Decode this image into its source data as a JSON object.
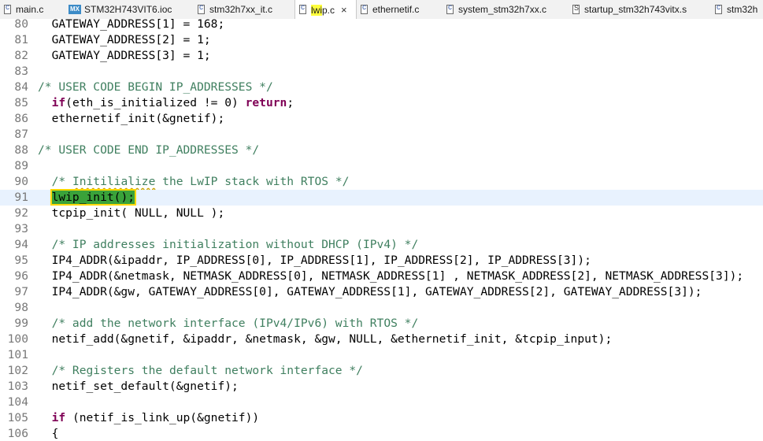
{
  "tabs": [
    {
      "label": "main.c",
      "icon": "c-file-icon",
      "active": false
    },
    {
      "label": "STM32H743VIT6.ioc",
      "icon": "mx-file-icon",
      "icon_text": "MX",
      "active": false
    },
    {
      "label": "stm32h7xx_it.c",
      "icon": "c-file-icon",
      "active": false
    },
    {
      "label": "lwip.c",
      "label_highlight": "lwi",
      "label_rest": "p.c",
      "icon": "c-file-icon",
      "active": true,
      "close_glyph": "×"
    },
    {
      "label": "ethernetif.c",
      "icon": "c-file-icon",
      "active": false
    },
    {
      "label": "system_stm32h7xx.c",
      "icon": "c-file-icon",
      "active": false
    },
    {
      "label": "startup_stm32h743vitx.s",
      "icon": "s-file-icon",
      "active": false
    },
    {
      "label": "stm32h",
      "icon": "c-file-icon",
      "active": false
    }
  ],
  "editor": {
    "current_line": 91,
    "lines": [
      {
        "n": "80",
        "code": "  GATEWAY_ADDRESS[1] = 168;"
      },
      {
        "n": "81",
        "code": "  GATEWAY_ADDRESS[2] = 1;"
      },
      {
        "n": "82",
        "code": "  GATEWAY_ADDRESS[3] = 1;"
      },
      {
        "n": "83",
        "code": ""
      },
      {
        "n": "84",
        "code": "/* USER CODE BEGIN IP_ADDRESSES */"
      },
      {
        "n": "85",
        "code": "  if(eth_is_initialized != 0) return;"
      },
      {
        "n": "86",
        "code": "  ethernetif_init(&gnetif);"
      },
      {
        "n": "87",
        "code": ""
      },
      {
        "n": "88",
        "code": "/* USER CODE END IP_ADDRESSES */"
      },
      {
        "n": "89",
        "code": ""
      },
      {
        "n": "90",
        "code": "  /* Initilialize the LwIP stack with RTOS */"
      },
      {
        "n": "91",
        "code": "  lwip_init();"
      },
      {
        "n": "92",
        "code": "  tcpip_init( NULL, NULL );"
      },
      {
        "n": "93",
        "code": ""
      },
      {
        "n": "94",
        "code": "  /* IP addresses initialization without DHCP (IPv4) */"
      },
      {
        "n": "95",
        "code": "  IP4_ADDR(&ipaddr, IP_ADDRESS[0], IP_ADDRESS[1], IP_ADDRESS[2], IP_ADDRESS[3]);"
      },
      {
        "n": "96",
        "code": "  IP4_ADDR(&netmask, NETMASK_ADDRESS[0], NETMASK_ADDRESS[1] , NETMASK_ADDRESS[2], NETMASK_ADDRESS[3]);"
      },
      {
        "n": "97",
        "code": "  IP4_ADDR(&gw, GATEWAY_ADDRESS[0], GATEWAY_ADDRESS[1], GATEWAY_ADDRESS[2], GATEWAY_ADDRESS[3]);"
      },
      {
        "n": "98",
        "code": ""
      },
      {
        "n": "99",
        "code": "  /* add the network interface (IPv4/IPv6) with RTOS */"
      },
      {
        "n": "100",
        "code": "  netif_add(&gnetif, &ipaddr, &netmask, &gw, NULL, &ethernetif_init, &tcpip_input);"
      },
      {
        "n": "101",
        "code": ""
      },
      {
        "n": "102",
        "code": "  /* Registers the default network interface */"
      },
      {
        "n": "103",
        "code": "  netif_set_default(&gnetif);"
      },
      {
        "n": "104",
        "code": ""
      },
      {
        "n": "105",
        "code": "  if (netif_is_link_up(&gnetif))"
      },
      {
        "n": "106",
        "code": "  {"
      }
    ]
  },
  "colors": {
    "comment": "#3f7f5f",
    "keyword": "#7f0055",
    "selection": "#3aa23a",
    "current_line": "#e8f2fe",
    "tab_highlight": "#ffff3c"
  }
}
